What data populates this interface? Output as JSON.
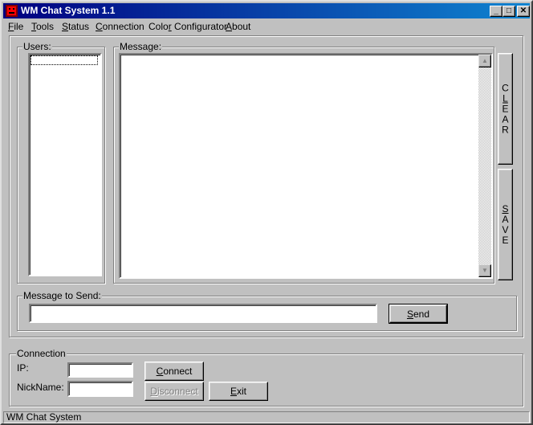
{
  "window": {
    "title": "WM Chat System 1.1"
  },
  "titlebar": {
    "minimize": "_",
    "maximize": "□",
    "close": "✕"
  },
  "menu": [
    {
      "label": "File",
      "underline": "F",
      "rest": "ile"
    },
    {
      "label": "Tools",
      "underline": "T",
      "rest": "ools"
    },
    {
      "label": "Status",
      "underline": "S",
      "rest": "tatus"
    },
    {
      "label": "Connection",
      "underline": "C",
      "rest": "onnection"
    },
    {
      "label": "Color Configurator",
      "pre": "Colo",
      "underline": "r",
      "rest": " Configurator"
    },
    {
      "label": "About",
      "underline": "A",
      "rest": "bout"
    }
  ],
  "users": {
    "label": "Users:",
    "items": []
  },
  "message": {
    "label": "Message:",
    "content": ""
  },
  "side_buttons": {
    "clear": [
      "C",
      "L",
      "E",
      "A",
      "R"
    ],
    "save": [
      "S",
      "A",
      "V",
      "E"
    ]
  },
  "send_box": {
    "label": "Message to Send:",
    "value": "",
    "send_pre": "",
    "send_u": "S",
    "send_rest": "end"
  },
  "connection": {
    "label": "Connection",
    "ip_label": "IP:",
    "ip_value": "",
    "nick_label": "NickName:",
    "nick_value": "",
    "connect_u": "C",
    "connect_rest": "onnect",
    "disconnect_u": "D",
    "disconnect_rest": "isconnect",
    "exit_u": "E",
    "exit_rest": "xit"
  },
  "status": {
    "text": "WM Chat System"
  }
}
